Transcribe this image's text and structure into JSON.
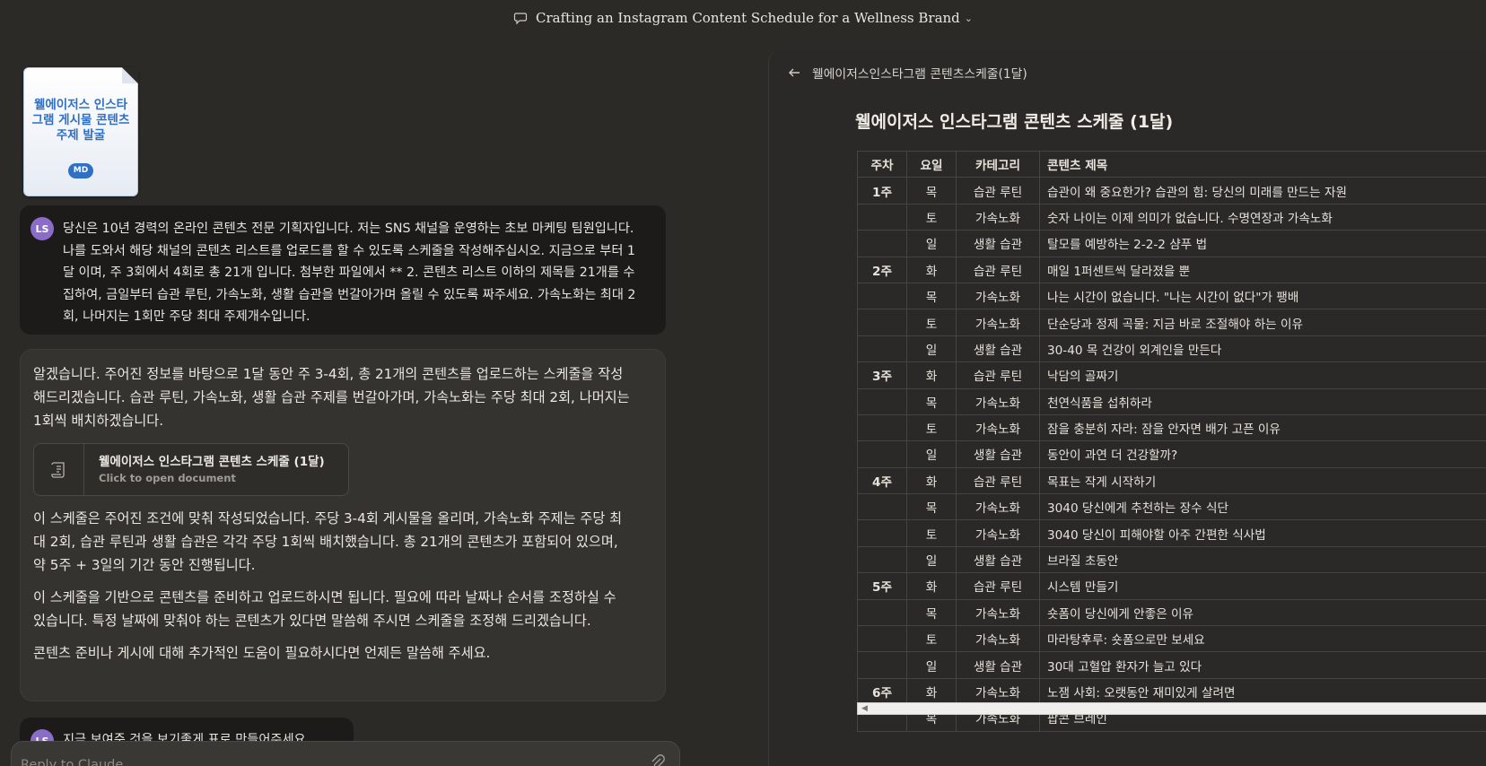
{
  "topbar": {
    "title": "Crafting an Instagram Content Schedule for a Wellness Brand"
  },
  "attachment": {
    "title": "웰에이저스 인스타그램 게시물 콘텐츠 주제 발굴",
    "badge": "MD"
  },
  "user_message": {
    "avatar": "LS",
    "text": "당신은 10년 경력의 온라인 콘텐츠 전문 기획자입니다. 저는 SNS 채널을 운영하는 초보 마케팅 팀원입니다. 나를 도와서 해당 채널의 콘텐츠 리스트를 업로드를 할 수 있도록 스케줄을 작성해주십시오. 지금으로 부터 1달 이며, 주 3회에서 4회로 총 21개 입니다. 첨부한 파일에서 ** 2. 콘텐츠 리스트 이하의 제목들 21개를 수집하여, 금일부터 습관 루틴, 가속노화, 생활 습관을 번갈아가며 올릴 수 있도록 짜주세요. 가속노화는 최대 2회, 나머지는 1회만 주당 최대 주제개수입니다."
  },
  "assistant_message": {
    "intro": "알겠습니다. 주어진 정보를 바탕으로 1달 동안 주 3-4회, 총 21개의 콘텐츠를 업로드하는 스케줄을 작성해드리겠습니다. 습관 루틴, 가속노화, 생활 습관 주제를 번갈아가며, 가속노화는 주당 최대 2회, 나머지는 1회씩 배치하겠습니다.",
    "artifact": {
      "title": "웰에이저스 인스타그램 콘텐츠 스케줄 (1달)",
      "subtitle": "Click to open document"
    },
    "paragraphs": [
      "이 스케줄은 주어진 조건에 맞춰 작성되었습니다. 주당 3-4회 게시물을 올리며, 가속노화 주제는 주당 최대 2회, 습관 루틴과 생활 습관은 각각 주당 1회씩 배치했습니다. 총 21개의 콘텐츠가 포함되어 있으며, 약 5주 + 3일의 기간 동안 진행됩니다.",
      "이 스케줄을 기반으로 콘텐츠를 준비하고 업로드하시면 됩니다. 필요에 따라 날짜나 순서를 조정하실 수 있습니다. 특정 날짜에 맞춰야 하는 콘텐츠가 있다면 말씀해 주시면 스케줄을 조정해 드리겠습니다.",
      "콘텐츠 준비나 게시에 대해 추가적인 도움이 필요하시다면 언제든 말씀해 주세요."
    ]
  },
  "user_message_2": {
    "avatar": "LS",
    "text": "지금 보여준 것을 보기좋게 표로 만들어주세요"
  },
  "reply_box": {
    "placeholder": "Reply to Claude..."
  },
  "panel": {
    "header_title": "웰에이저스인스타그램 콘텐츠스케줄(1달)",
    "doc_title": "웰에이저스 인스타그램 콘텐츠 스케줄 (1달)",
    "table": {
      "headers": [
        "주차",
        "요일",
        "카테고리",
        "콘텐츠 제목"
      ],
      "rows": [
        [
          "1주",
          "목",
          "습관 루틴",
          "습관이 왜 중요한가? 습관의 힘: 당신의 미래를 만드는 자원"
        ],
        [
          "",
          "토",
          "가속노화",
          "숫자 나이는 이제 의미가 없습니다. 수명연장과 가속노화"
        ],
        [
          "",
          "일",
          "생활 습관",
          "탈모를 예방하는 2-2-2 샴푸 법"
        ],
        [
          "2주",
          "화",
          "습관 루틴",
          "매일 1퍼센트씩 달라졌을 뿐"
        ],
        [
          "",
          "목",
          "가속노화",
          "나는 시간이 없습니다. \"나는 시간이 없다\"가 팽배"
        ],
        [
          "",
          "토",
          "가속노화",
          "단순당과 정제 곡물: 지금 바로 조절해야 하는 이유"
        ],
        [
          "",
          "일",
          "생활 습관",
          "30-40 목 건강이 외계인을 만든다"
        ],
        [
          "3주",
          "화",
          "습관 루틴",
          "낙담의 골짜기"
        ],
        [
          "",
          "목",
          "가속노화",
          "천연식품을 섭취하라"
        ],
        [
          "",
          "토",
          "가속노화",
          "잠을 충분히 자라: 잠을 안자면 배가 고픈 이유"
        ],
        [
          "",
          "일",
          "생활 습관",
          "동안이 과연 더 건강할까?"
        ],
        [
          "4주",
          "화",
          "습관 루틴",
          "목표는 작게 시작하기"
        ],
        [
          "",
          "목",
          "가속노화",
          "3040 당신에게 추천하는 장수 식단"
        ],
        [
          "",
          "토",
          "가속노화",
          "3040 당신이 피해야할 아주 간편한 식사법"
        ],
        [
          "",
          "일",
          "생활 습관",
          "브라질 초동안"
        ],
        [
          "5주",
          "화",
          "습관 루틴",
          "시스템 만들기"
        ],
        [
          "",
          "목",
          "가속노화",
          "숏폼이 당신에게 안좋은 이유"
        ],
        [
          "",
          "토",
          "가속노화",
          "마라탕후루: 숏폼으로만 보세요"
        ],
        [
          "",
          "일",
          "생활 습관",
          "30대 고혈압 환자가 늘고 있다"
        ],
        [
          "6주",
          "화",
          "가속노화",
          "노잼 사회: 오랫동안 재미있게 살려면"
        ],
        [
          "",
          "목",
          "가속노화",
          "팝콘 브레인"
        ]
      ]
    }
  }
}
